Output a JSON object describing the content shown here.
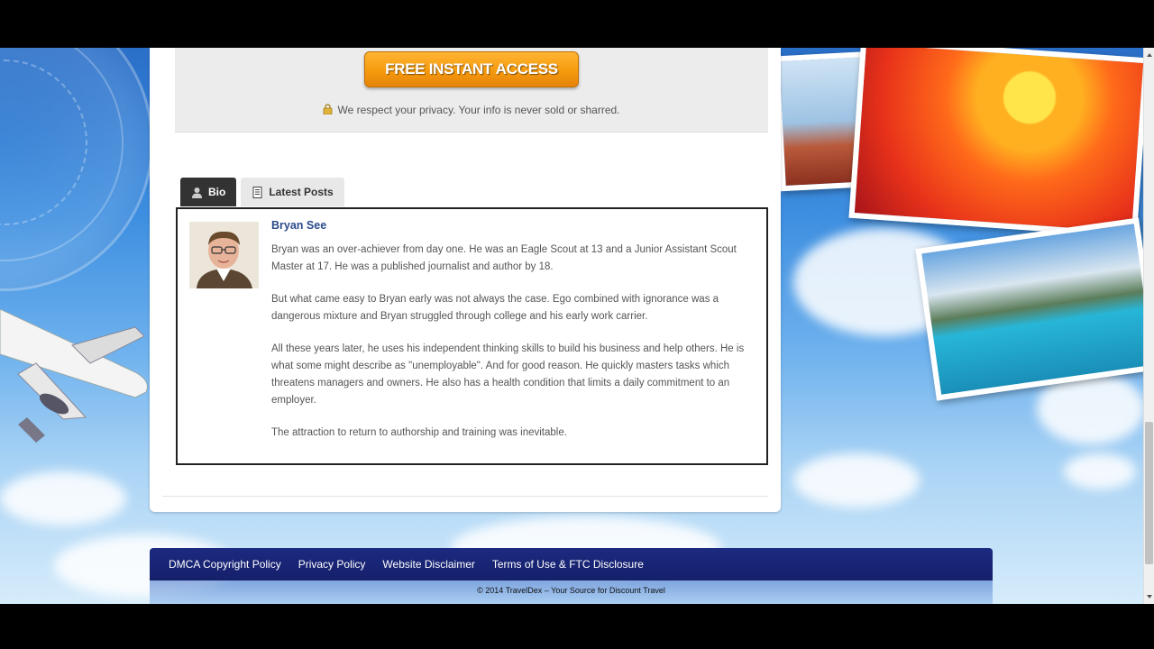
{
  "optin": {
    "cta_label": "FREE INSTANT ACCESS",
    "privacy_text": "We respect your privacy. Your info is never sold or sharred.",
    "lock_icon": "lock-icon"
  },
  "tabs": [
    {
      "label": "Bio",
      "icon": "user-icon",
      "active": true
    },
    {
      "label": "Latest Posts",
      "icon": "document-icon",
      "active": false
    }
  ],
  "author": {
    "name": "Bryan See",
    "bio": [
      "Bryan was an over-achiever from day one. He was an Eagle Scout at 13 and a Junior Assistant Scout Master at 17. He was a published journalist and author by 18.",
      "But what came easy to Bryan early was not always the case. Ego combined with ignorance was a dangerous mixture and Bryan struggled through college and his early work carrier.",
      "All these years later, he uses his independent thinking skills to build his business and help others. He is what some might describe as \"unemployable\". And for good reason. He quickly masters tasks which threatens managers and owners. He also has a health condition that limits a daily commitment to an employer.",
      "The attraction to return to authorship and training was inevitable."
    ]
  },
  "footer": {
    "links": [
      "DMCA Copyright Policy",
      "Privacy Policy",
      "Website Disclaimer",
      "Terms of Use & FTC Disclosure"
    ],
    "copyright": "© 2014 TravelDex – Your Source for Discount Travel"
  },
  "colors": {
    "cta": "#f59a0e",
    "author_name": "#2a4b8c",
    "footer_bar": "#1c2a80",
    "tab_active": "#333333"
  }
}
